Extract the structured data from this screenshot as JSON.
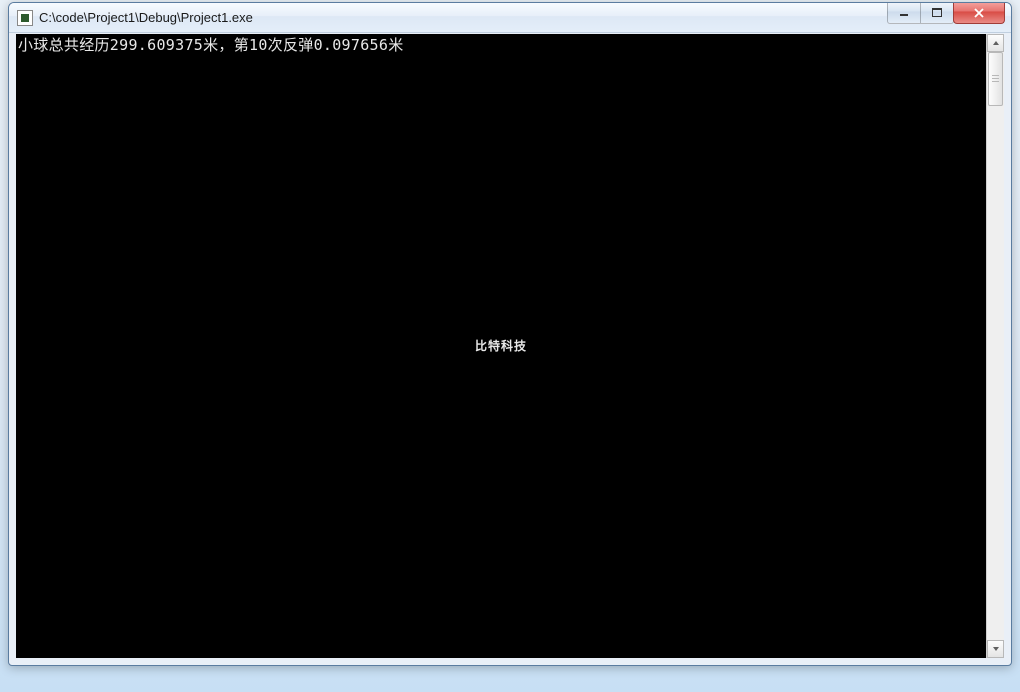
{
  "window": {
    "title": "C:\\code\\Project1\\Debug\\Project1.exe"
  },
  "console": {
    "line1": "小球总共经历299.609375米，第10次反弹0.097656米",
    "watermark": "比特科技"
  },
  "controls": {
    "minimize": "minimize",
    "maximize": "maximize",
    "close": "close"
  }
}
